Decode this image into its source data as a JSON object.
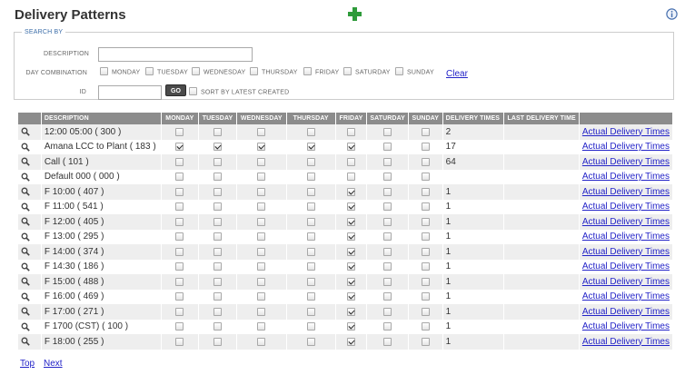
{
  "page": {
    "title": "Delivery Patterns",
    "add_icon": "plus-icon",
    "info_icon": "info-icon",
    "accent_color": "#3c9a3c"
  },
  "search": {
    "legend": "SEARCH BY",
    "description_label": "DESCRIPTION",
    "description_value": "",
    "day_combination_label": "DAY COMBINATION",
    "days": [
      "MONDAY",
      "TUESDAY",
      "WEDNESDAY",
      "THURSDAY",
      "FRIDAY",
      "SATURDAY",
      "SUNDAY"
    ],
    "clear_label": "Clear",
    "id_label": "ID",
    "id_value": "",
    "go_label": "GO",
    "sort_label": "SORT BY LATEST CREATED"
  },
  "table": {
    "columns": [
      "DESCRIPTION",
      "MONDAY",
      "TUESDAY",
      "WEDNESDAY",
      "THURSDAY",
      "FRIDAY",
      "SATURDAY",
      "SUNDAY",
      "DELIVERY TIMES",
      "LAST DELIVERY TIME"
    ],
    "link_text": "Actual Delivery Times",
    "rows": [
      {
        "name": "12:00 05:00",
        "id": "300",
        "days": [
          0,
          0,
          0,
          0,
          0,
          0,
          0
        ],
        "delivery_times": "2",
        "last_delivery_time": ""
      },
      {
        "name": "Amana LCC to Plant",
        "id": "183",
        "days": [
          1,
          1,
          1,
          1,
          1,
          0,
          0
        ],
        "delivery_times": "17",
        "last_delivery_time": ""
      },
      {
        "name": "Call",
        "id": "101",
        "days": [
          0,
          0,
          0,
          0,
          0,
          0,
          0
        ],
        "delivery_times": "64",
        "last_delivery_time": ""
      },
      {
        "name": "Default 000",
        "id": "000",
        "days": [
          0,
          0,
          0,
          0,
          0,
          0,
          0
        ],
        "delivery_times": "",
        "last_delivery_time": ""
      },
      {
        "name": "F 10:00",
        "id": "407",
        "days": [
          0,
          0,
          0,
          0,
          1,
          0,
          0
        ],
        "delivery_times": "1",
        "last_delivery_time": ""
      },
      {
        "name": "F 11:00",
        "id": "541",
        "days": [
          0,
          0,
          0,
          0,
          1,
          0,
          0
        ],
        "delivery_times": "1",
        "last_delivery_time": ""
      },
      {
        "name": "F 12:00",
        "id": "405",
        "days": [
          0,
          0,
          0,
          0,
          1,
          0,
          0
        ],
        "delivery_times": "1",
        "last_delivery_time": ""
      },
      {
        "name": "F 13:00",
        "id": "295",
        "days": [
          0,
          0,
          0,
          0,
          1,
          0,
          0
        ],
        "delivery_times": "1",
        "last_delivery_time": ""
      },
      {
        "name": "F 14:00",
        "id": "374",
        "days": [
          0,
          0,
          0,
          0,
          1,
          0,
          0
        ],
        "delivery_times": "1",
        "last_delivery_time": ""
      },
      {
        "name": "F 14:30",
        "id": "186",
        "days": [
          0,
          0,
          0,
          0,
          1,
          0,
          0
        ],
        "delivery_times": "1",
        "last_delivery_time": ""
      },
      {
        "name": "F 15:00",
        "id": "488",
        "days": [
          0,
          0,
          0,
          0,
          1,
          0,
          0
        ],
        "delivery_times": "1",
        "last_delivery_time": ""
      },
      {
        "name": "F 16:00",
        "id": "469",
        "days": [
          0,
          0,
          0,
          0,
          1,
          0,
          0
        ],
        "delivery_times": "1",
        "last_delivery_time": ""
      },
      {
        "name": "F 17:00",
        "id": "271",
        "days": [
          0,
          0,
          0,
          0,
          1,
          0,
          0
        ],
        "delivery_times": "1",
        "last_delivery_time": ""
      },
      {
        "name": "F 1700 (CST)",
        "id": "100",
        "days": [
          0,
          0,
          0,
          0,
          1,
          0,
          0
        ],
        "delivery_times": "1",
        "last_delivery_time": ""
      },
      {
        "name": "F 18:00",
        "id": "255",
        "days": [
          0,
          0,
          0,
          0,
          1,
          0,
          0
        ],
        "delivery_times": "1",
        "last_delivery_time": ""
      }
    ]
  },
  "footer": {
    "top_label": "Top",
    "next_label": "Next"
  }
}
